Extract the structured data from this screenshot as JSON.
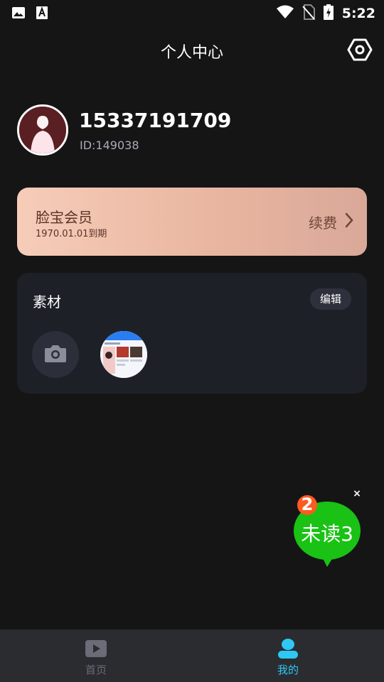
{
  "status_bar": {
    "time": "5:22",
    "icons": [
      "image-icon",
      "text-a-icon",
      "wifi-icon",
      "no-sim-icon",
      "battery-charging-icon"
    ]
  },
  "header": {
    "title": "个人中心",
    "settings_icon": "settings-hexagon-icon"
  },
  "profile": {
    "phone": "15337191709",
    "id_text": "ID:149038"
  },
  "vip": {
    "title": "脸宝会员",
    "expire": "1970.01.01到期",
    "renew_label": "续费",
    "colors": {
      "gradient_start": "#f6cdb9",
      "gradient_end": "#d9a898",
      "text": "#5b3226"
    }
  },
  "materials": {
    "title": "素材",
    "edit_label": "编辑",
    "camera_icon": "camera-icon"
  },
  "float_badge": {
    "count": "2",
    "text": "未读3",
    "close": "×",
    "colors": {
      "bubble": "#19c214",
      "badge": "#ff5a1f"
    }
  },
  "bottom_nav": {
    "items": [
      {
        "label": "首页",
        "icon": "play-icon",
        "active": false
      },
      {
        "label": "我的",
        "icon": "user-icon",
        "active": true
      }
    ],
    "colors": {
      "active": "#2dc8f6",
      "inactive": "#6a6d78"
    }
  },
  "colors": {
    "background": "#151515",
    "card": "#1e2028"
  }
}
